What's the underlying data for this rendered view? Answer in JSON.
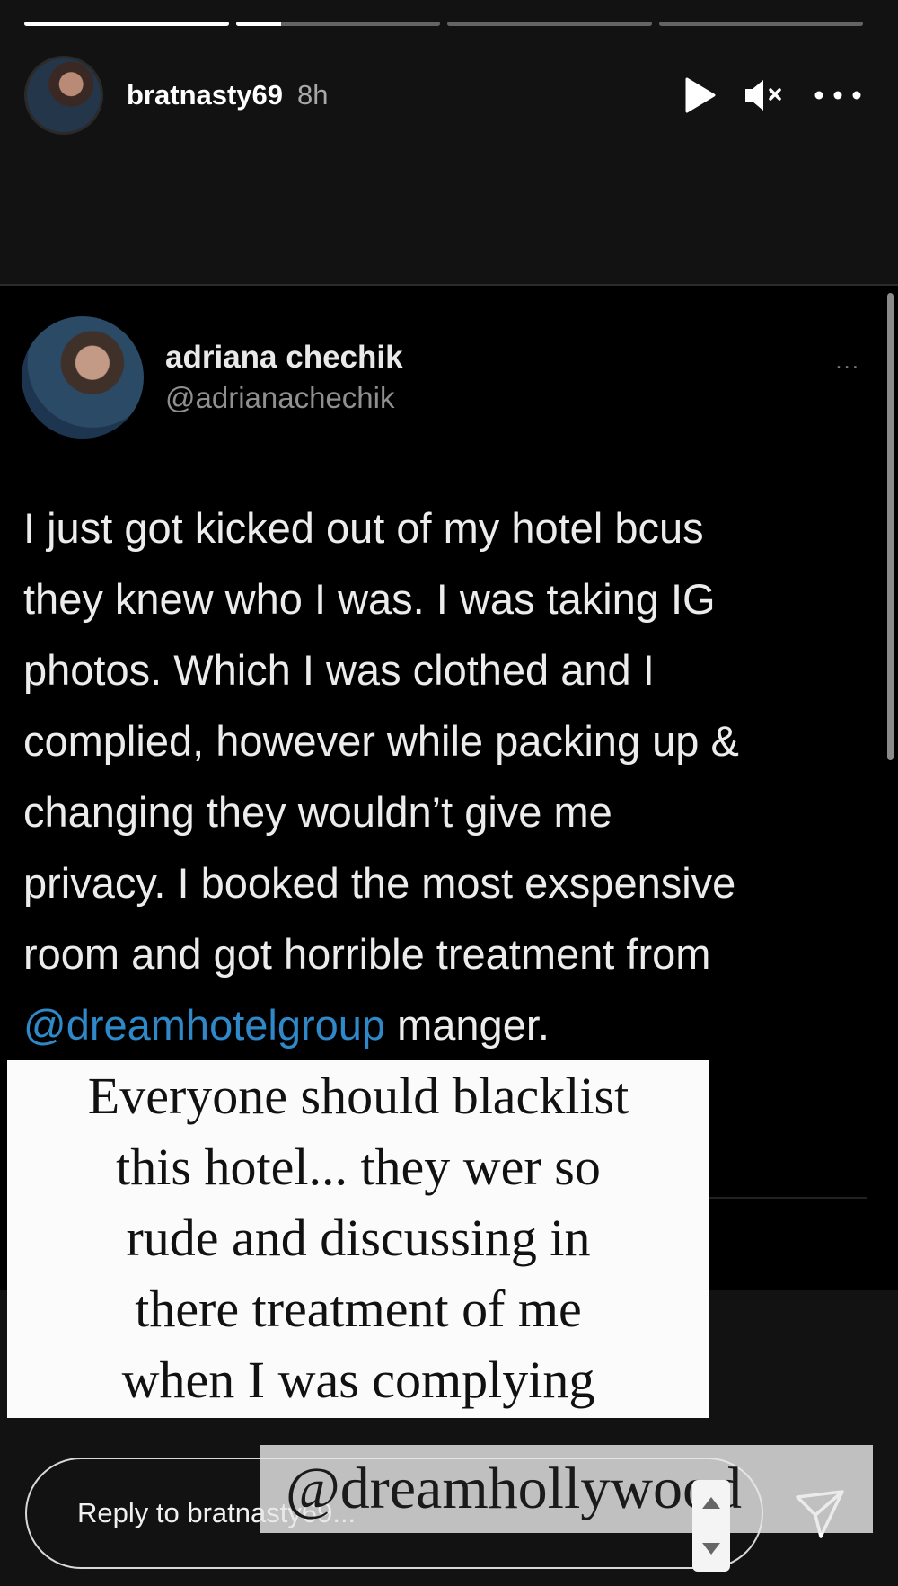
{
  "story": {
    "progress": [
      1.0,
      0.22,
      0.0,
      0.0
    ],
    "username": "bratnasty69",
    "time_ago": "8h",
    "icons": {
      "play": "play-icon",
      "mute": "muted-speaker-icon",
      "more": "more-dots-icon",
      "send": "send-icon"
    }
  },
  "tweet": {
    "author_name": "adriana chechik",
    "author_handle": "@adrianachechik",
    "more": "...",
    "text_lines": [
      "I just got kicked out of my hotel bcus",
      "they knew who I was. I was taking IG",
      "photos. Which I was clothed and I",
      "complied, however while packing up &",
      "changing they wouldn’t give me",
      "privacy. I booked the most exspensive",
      "room and got horrible treatment from"
    ],
    "mention": "@dreamhotelgroup",
    "mention_suffix": " manger."
  },
  "overlay_text": {
    "lines": [
      "Everyone should blacklist",
      "this hotel... they wer so",
      "rude and discussing in",
      "there treatment of me",
      "when I was complying"
    ]
  },
  "tag_sticker": "@dreamhollywood",
  "reply": {
    "placeholder": "Reply to bratnasty69..."
  },
  "colors": {
    "mention": "#2f88c8",
    "background": "#121212"
  }
}
